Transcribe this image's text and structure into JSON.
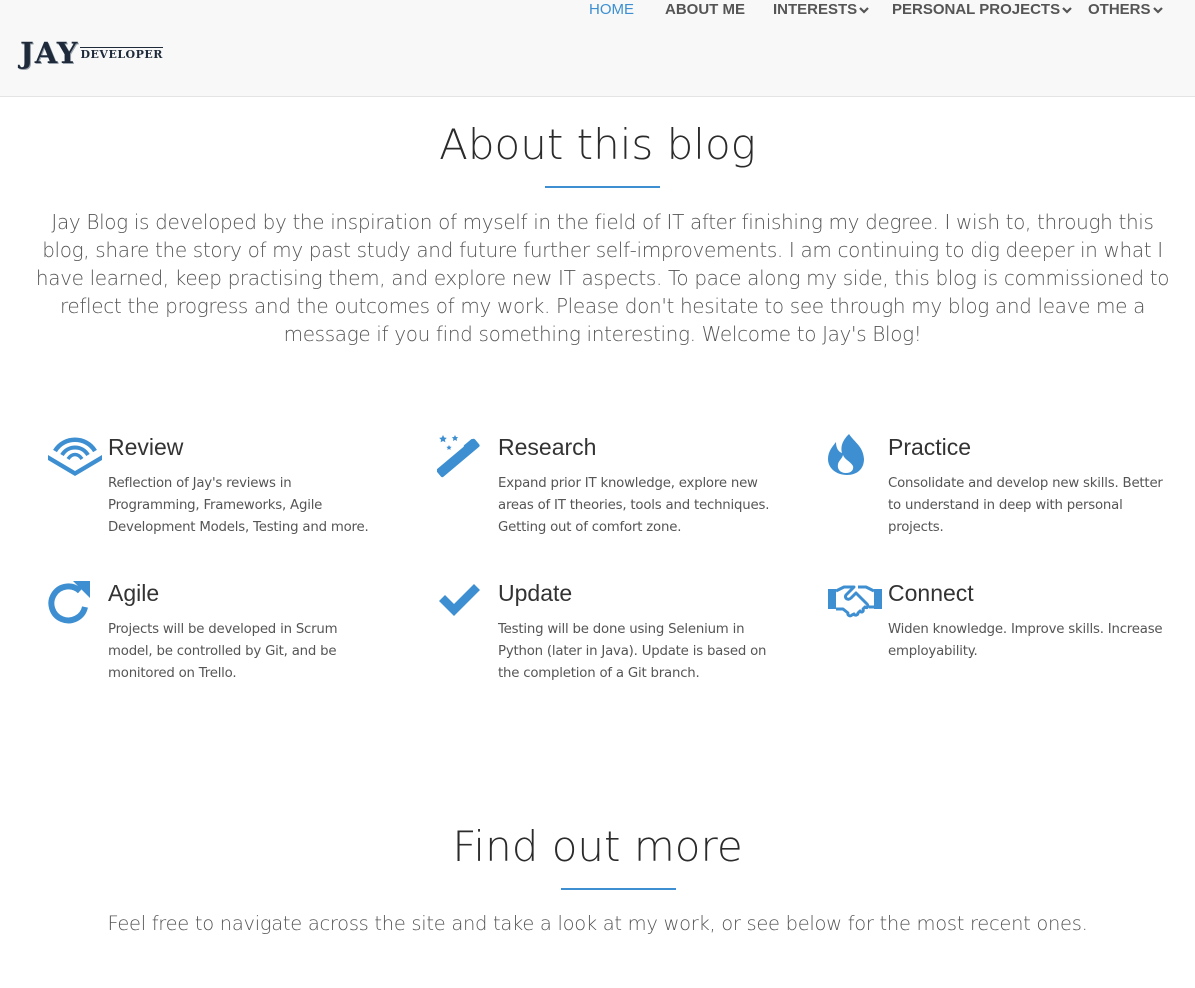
{
  "logo": {
    "main": "JAY",
    "sub": "DEVELOPER"
  },
  "nav": {
    "items": [
      {
        "label": "HOME",
        "active": true,
        "dropdown": false
      },
      {
        "label": "ABOUT ME",
        "active": false,
        "dropdown": false
      },
      {
        "label": "INTERESTS",
        "active": false,
        "dropdown": true
      },
      {
        "label": "PERSONAL PROJECTS",
        "active": false,
        "dropdown": true
      },
      {
        "label": "OTHERS",
        "active": false,
        "dropdown": true
      }
    ]
  },
  "about": {
    "title": "About this blog",
    "text": "Jay Blog is developed by the inspiration of myself in the field of IT after finishing my degree. I wish to, through this blog, share the story of my past study and future further self-improvements. I am continuing to dig deeper in what I have learned, keep practising them, and explore new IT aspects. To pace along my side, this blog is commissioned to reflect the progress and the outcomes of my work. Please don't hesitate to see through my blog and leave me a message if you find something interesting. Welcome to Jay's Blog!"
  },
  "features": [
    {
      "icon": "audible-icon",
      "title": "Review",
      "text": "Reflection of Jay's reviews in Programming, Frameworks, Agile Development Models, Testing and more."
    },
    {
      "icon": "magic-wand-icon",
      "title": "Research",
      "text": "Expand prior IT knowledge, explore new areas of IT theories, tools and techniques. Getting out of comfort zone."
    },
    {
      "icon": "fire-icon",
      "title": "Practice",
      "text": "Consolidate and develop new skills. Better to understand in deep with personal projects."
    },
    {
      "icon": "refresh-icon",
      "title": "Agile",
      "text": "Projects will be developed in Scrum model, be controlled by Git, and be monitored on Trello."
    },
    {
      "icon": "checkmark-icon",
      "title": "Update",
      "text": "Testing will be done using Selenium in Python (later in Java). Update is based on the completion of a Git branch."
    },
    {
      "icon": "handshake-icon",
      "title": "Connect",
      "text": "Widen knowledge. Improve skills. Increase employability."
    }
  ],
  "more": {
    "title": "Find out more",
    "text": "Feel free to navigate across the site and take a look at my work, or see below for the most recent ones."
  },
  "colors": {
    "accent": "#3d8fd1",
    "navbar_bg": "#f8f8f8",
    "text": "#555555",
    "heading": "#2b2b2b"
  }
}
